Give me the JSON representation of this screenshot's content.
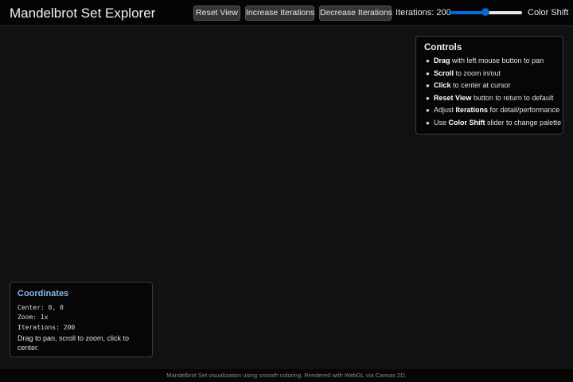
{
  "header": {
    "title": "Mandelbrot Set Explorer",
    "buttons": {
      "reset": "Reset View",
      "increase": "Increase Iterations",
      "decrease": "Decrease Iterations"
    },
    "iterations_label": "Iterations: 200",
    "color_shift": {
      "label": "Color Shift",
      "value_fraction": 0.5,
      "accent_color": "#0a6bd6"
    }
  },
  "controls": {
    "title": "Controls",
    "items": [
      {
        "bold": "Drag",
        "text": " with left mouse button to pan"
      },
      {
        "bold": "Scroll",
        "text": " to zoom in/out"
      },
      {
        "bold": "Click",
        "text": " to center at cursor"
      },
      {
        "bold": "Reset View",
        "text": " button to return to default"
      },
      {
        "prefix": "Adjust ",
        "bold": "Iterations",
        "text": " for detail/performance"
      },
      {
        "prefix": "Use ",
        "bold": "Color Shift",
        "text": " slider to change palette"
      }
    ]
  },
  "coordinates": {
    "title": "Coordinates",
    "center": "Center: 0, 0",
    "zoom": "Zoom: 1x",
    "iterations": "Iterations: 200",
    "hint": "Drag to pan, scroll to zoom, click to center."
  },
  "footer": {
    "text": "Mandelbrot Set visualization using smooth coloring. Rendered with WebGL via Canvas 2D."
  },
  "colors": {
    "background": "#111111",
    "coordinates_title": "#8fb4ee"
  }
}
